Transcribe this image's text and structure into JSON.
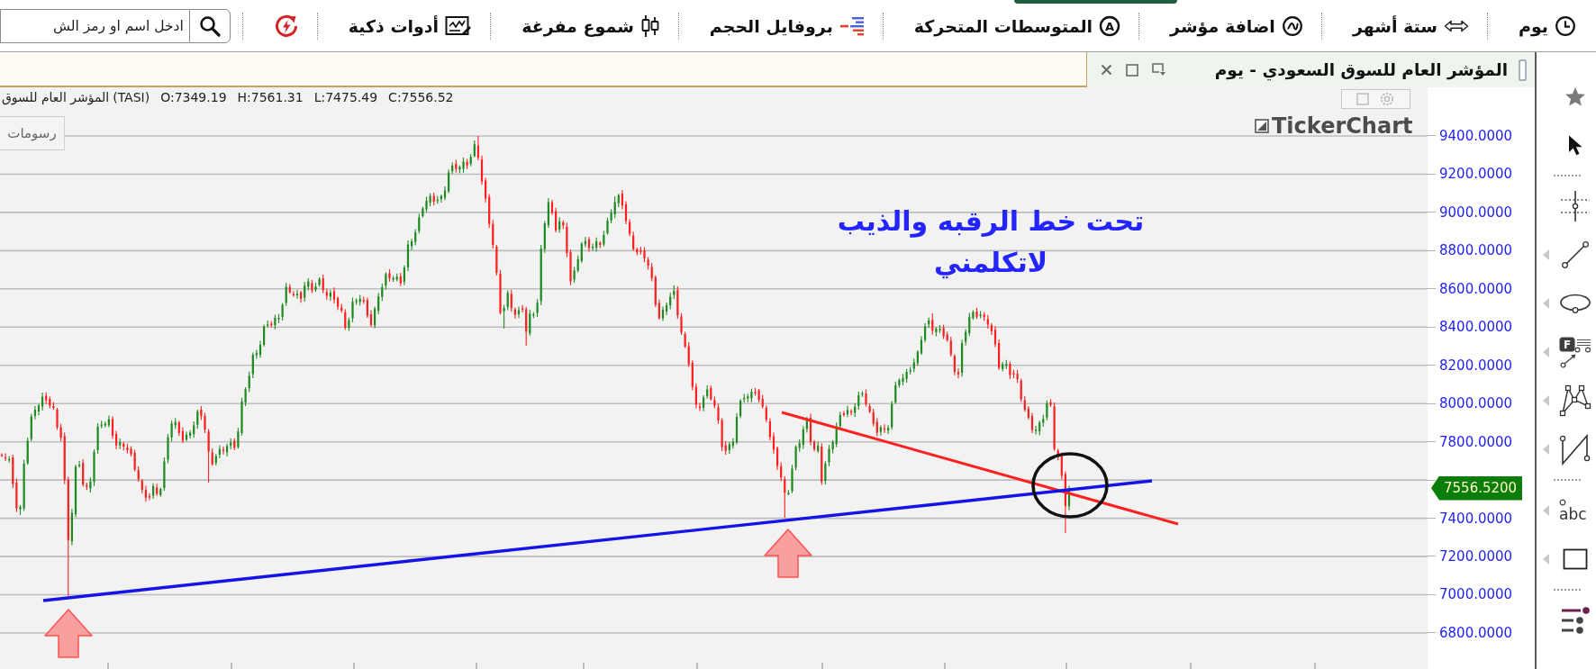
{
  "toolbar": {
    "items": [
      {
        "kind": "interval",
        "label": "يوم"
      },
      {
        "kind": "period",
        "label": "ستة أشهر"
      },
      {
        "kind": "indicator",
        "label": "اضافة مؤشر"
      },
      {
        "kind": "moving_average",
        "icon_text": "A",
        "label": "المتوسطات المتحركة"
      },
      {
        "kind": "volume_profile",
        "label": "بروفايل الحجم"
      },
      {
        "kind": "hollow_candles",
        "label": "شموع مفرغة"
      },
      {
        "kind": "smart_tools",
        "label": "أدوات ذكية"
      },
      {
        "kind": "refresh"
      }
    ],
    "search": {
      "placeholder": "ادخل اسم او رمز الش"
    }
  },
  "chart": {
    "title": "المؤشر العام للسوق السعودي - يوم",
    "info": {
      "name": "المؤشر العام للسوق",
      "symbol": "(TASI)",
      "values": [
        "C:7556.52",
        "L:7475.49",
        "H:7561.31",
        "O:7349.19"
      ]
    },
    "drawings_button": "رسومات",
    "logo": "TickerChart",
    "annotation": "تحت خط الرقبه والذيب\nلاتكلمني",
    "price_axis": [
      {
        "kind": "tick",
        "label": "9400.0000"
      },
      {
        "kind": "tick",
        "label": "9200.0000"
      },
      {
        "kind": "tick",
        "label": "9000.0000"
      },
      {
        "kind": "tick",
        "label": "8800.0000"
      },
      {
        "kind": "tick",
        "label": "8600.0000"
      },
      {
        "kind": "tick",
        "label": "8400.0000"
      },
      {
        "kind": "tick",
        "label": "8200.0000"
      },
      {
        "kind": "tick",
        "label": "8000.0000"
      },
      {
        "kind": "tick",
        "label": "7800.0000"
      },
      {
        "kind": "last_price",
        "label": "7556.5200"
      },
      {
        "kind": "tick",
        "label": "7400.0000"
      },
      {
        "kind": "tick",
        "label": "7200.0000"
      },
      {
        "kind": "tick",
        "label": "7000.0000"
      },
      {
        "kind": "tick",
        "label": "6800.0000"
      }
    ]
  },
  "sidebar": {
    "groups": [
      {
        "tools": [
          {
            "kind": "favorite",
            "flyout": false
          },
          {
            "kind": "pointer",
            "flyout": false
          }
        ]
      },
      {
        "tools": [
          {
            "kind": "crosshair",
            "flyout": false
          },
          {
            "kind": "line",
            "flyout": true
          },
          {
            "kind": "ellipse",
            "flyout": true
          },
          {
            "kind": "fibonacci",
            "icon_text": "F",
            "flyout": true
          },
          {
            "kind": "pattern",
            "flyout": true
          },
          {
            "kind": "channel",
            "flyout": true
          }
        ]
      },
      {
        "tools": [
          {
            "kind": "text",
            "icon_text": "abc",
            "flyout": true
          },
          {
            "kind": "rectangle",
            "flyout": true
          }
        ]
      },
      {
        "tools": [
          {
            "kind": "settings",
            "flyout": false
          }
        ]
      }
    ]
  }
}
